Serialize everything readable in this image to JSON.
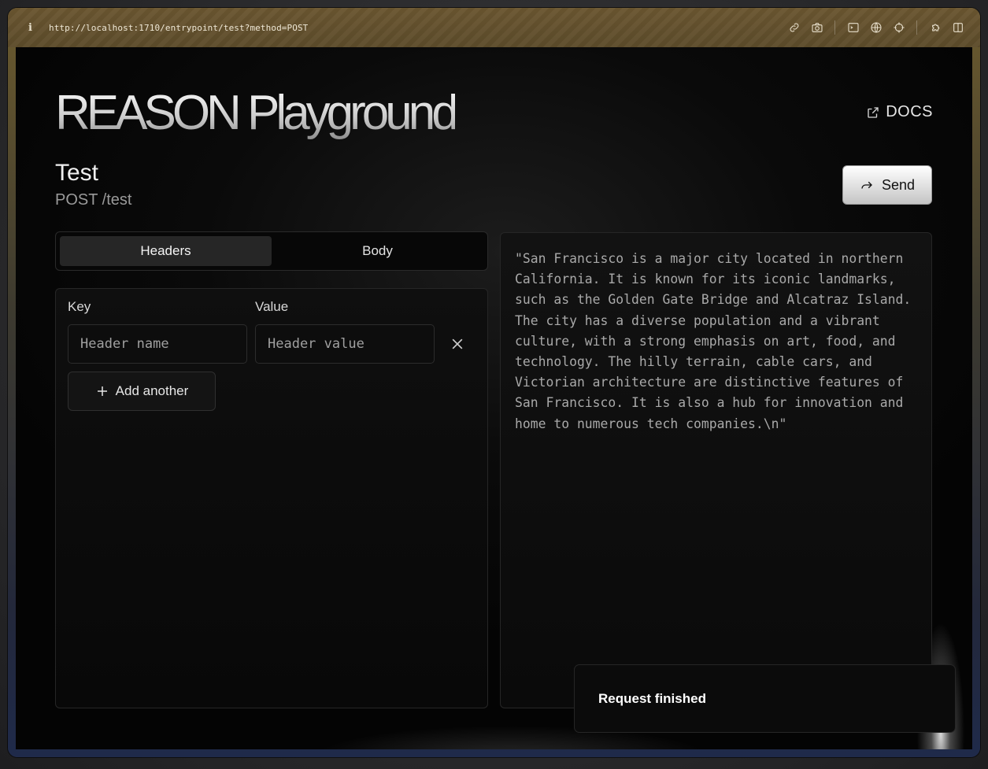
{
  "browser": {
    "url": "http://localhost:1710/entrypoint/test?method=POST",
    "info_icon": "i"
  },
  "header": {
    "brand": "REASON Playground",
    "docs_label": "DOCS"
  },
  "endpoint": {
    "title": "Test",
    "method_path": "POST /test",
    "send_label": "Send"
  },
  "tabs": [
    {
      "label": "Headers",
      "active": true
    },
    {
      "label": "Body",
      "active": false
    }
  ],
  "headers_panel": {
    "key_label": "Key",
    "value_label": "Value",
    "key_placeholder": "Header name",
    "value_placeholder": "Header value",
    "add_label": "Add another"
  },
  "output": {
    "text": "\"San Francisco is a major city located in northern California. It is known for its iconic landmarks, such as the Golden Gate Bridge and Alcatraz Island. The city has a diverse population and a vibrant culture, with a strong emphasis on art, food, and technology. The hilly terrain, cable cars, and Victorian architecture are distinctive features of San Francisco. It is also a hub for innovation and home to numerous tech companies.\\n\""
  },
  "toast": {
    "message": "Request finished"
  }
}
